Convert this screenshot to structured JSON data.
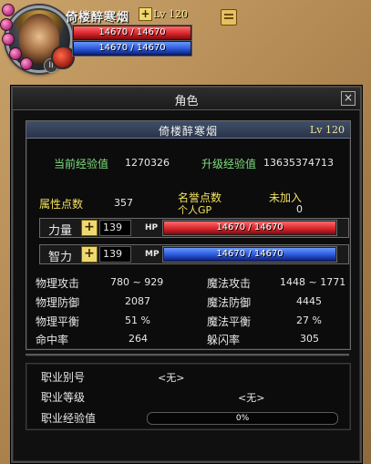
{
  "hud": {
    "name": "倚楼醉寒烟",
    "level": "Lv 120",
    "hp_text": "14670 / 14670",
    "mp_text": "14670 / 14670",
    "hp_fraction": 1.0,
    "mp_fraction": 1.0,
    "badge": "II"
  },
  "window": {
    "title": "角色",
    "close": "×"
  },
  "character": {
    "name": "倚楼醉寒烟",
    "level": "Lv 120"
  },
  "experience": {
    "current_label": "当前经验值",
    "current_value": "1270326",
    "next_label": "升级经验值",
    "next_value": "13635374713"
  },
  "points": {
    "attr_label": "属性点数",
    "attr_value": "357",
    "honor_label": "名誉点数",
    "honor_value": "未加入",
    "gp_label": "个人GP",
    "gp_value": "0"
  },
  "stats": {
    "str_label": "力量",
    "str_value": "139",
    "int_label": "智力",
    "int_value": "139",
    "hp_label": "HP",
    "mp_label": "MP",
    "hp_text": "14670 / 14670",
    "mp_text": "14670 / 14670",
    "hp_fraction": 1.0,
    "mp_fraction": 1.0
  },
  "combat": [
    {
      "label": "物理攻击",
      "value": "780 ~ 929",
      "label2": "魔法攻击",
      "value2": "1448 ~ 1771"
    },
    {
      "label": "物理防御",
      "value": "2087",
      "label2": "魔法防御",
      "value2": "4445"
    },
    {
      "label": "物理平衡",
      "value": "51 %",
      "label2": "魔法平衡",
      "value2": "27 %"
    },
    {
      "label": "命中率",
      "value": "264",
      "label2": "躲闪率",
      "value2": "305"
    }
  ],
  "job": {
    "title_label": "职业别号",
    "title_value": "<无>",
    "level_label": "职业等级",
    "level_value": "<无>",
    "exp_label": "职业经验值",
    "exp_text": "0%",
    "exp_fraction": 0
  },
  "colors": {
    "hp": "#d8262c",
    "mp": "#2a58d8"
  }
}
